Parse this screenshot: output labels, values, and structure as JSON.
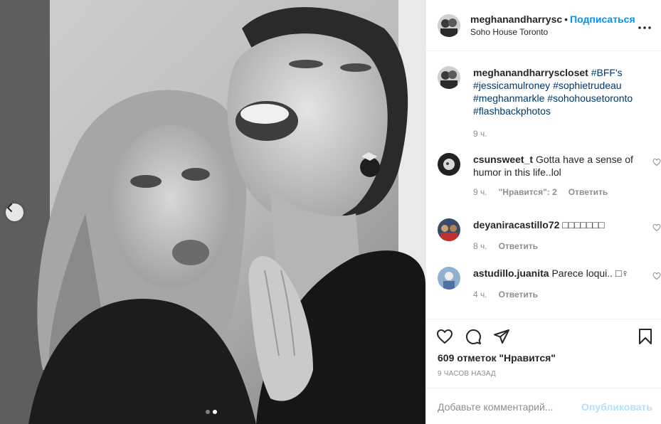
{
  "post": {
    "header": {
      "username": "meghanandharrysc",
      "bullet": "•",
      "follow_label": "Подписаться",
      "location": "Soho House Toronto",
      "more_icon": "more-horizontal-icon"
    },
    "caption": {
      "username": "meghanandharryscloset",
      "text_parts": [
        "#BFF's",
        "#jessicamulroney",
        "#sophietrudeau",
        "#meghanmarkle",
        "#sohohousetoronto",
        "#flashbackphotos"
      ],
      "time": "9 ч."
    },
    "comments": [
      {
        "username": "csunsweet_t",
        "text": "Gotta have a sense of humor in this life..lol",
        "time": "9 ч.",
        "likes": "\"Нравится\": 2",
        "reply": "Ответить"
      },
      {
        "username": "deyaniracastillo72",
        "text": "□□□□□□□",
        "time": "8 ч.",
        "reply": "Ответить"
      },
      {
        "username": "astudillo.juanita",
        "text": "Parece loqui.. □♀",
        "time": "4 ч.",
        "reply": "Ответить"
      }
    ],
    "likes_count": "609 отметок \"Нравится\"",
    "time_ago": "9 часов назад",
    "add_comment_placeholder": "Добавьте комментарий...",
    "publish_label": "Опубликовать",
    "carousel": {
      "current": 2,
      "total": 2
    }
  },
  "colors": {
    "accent": "#0095f6",
    "publish_disabled": "#b2dffc",
    "hashtag": "#00376b",
    "muted": "#8e8e8e"
  }
}
